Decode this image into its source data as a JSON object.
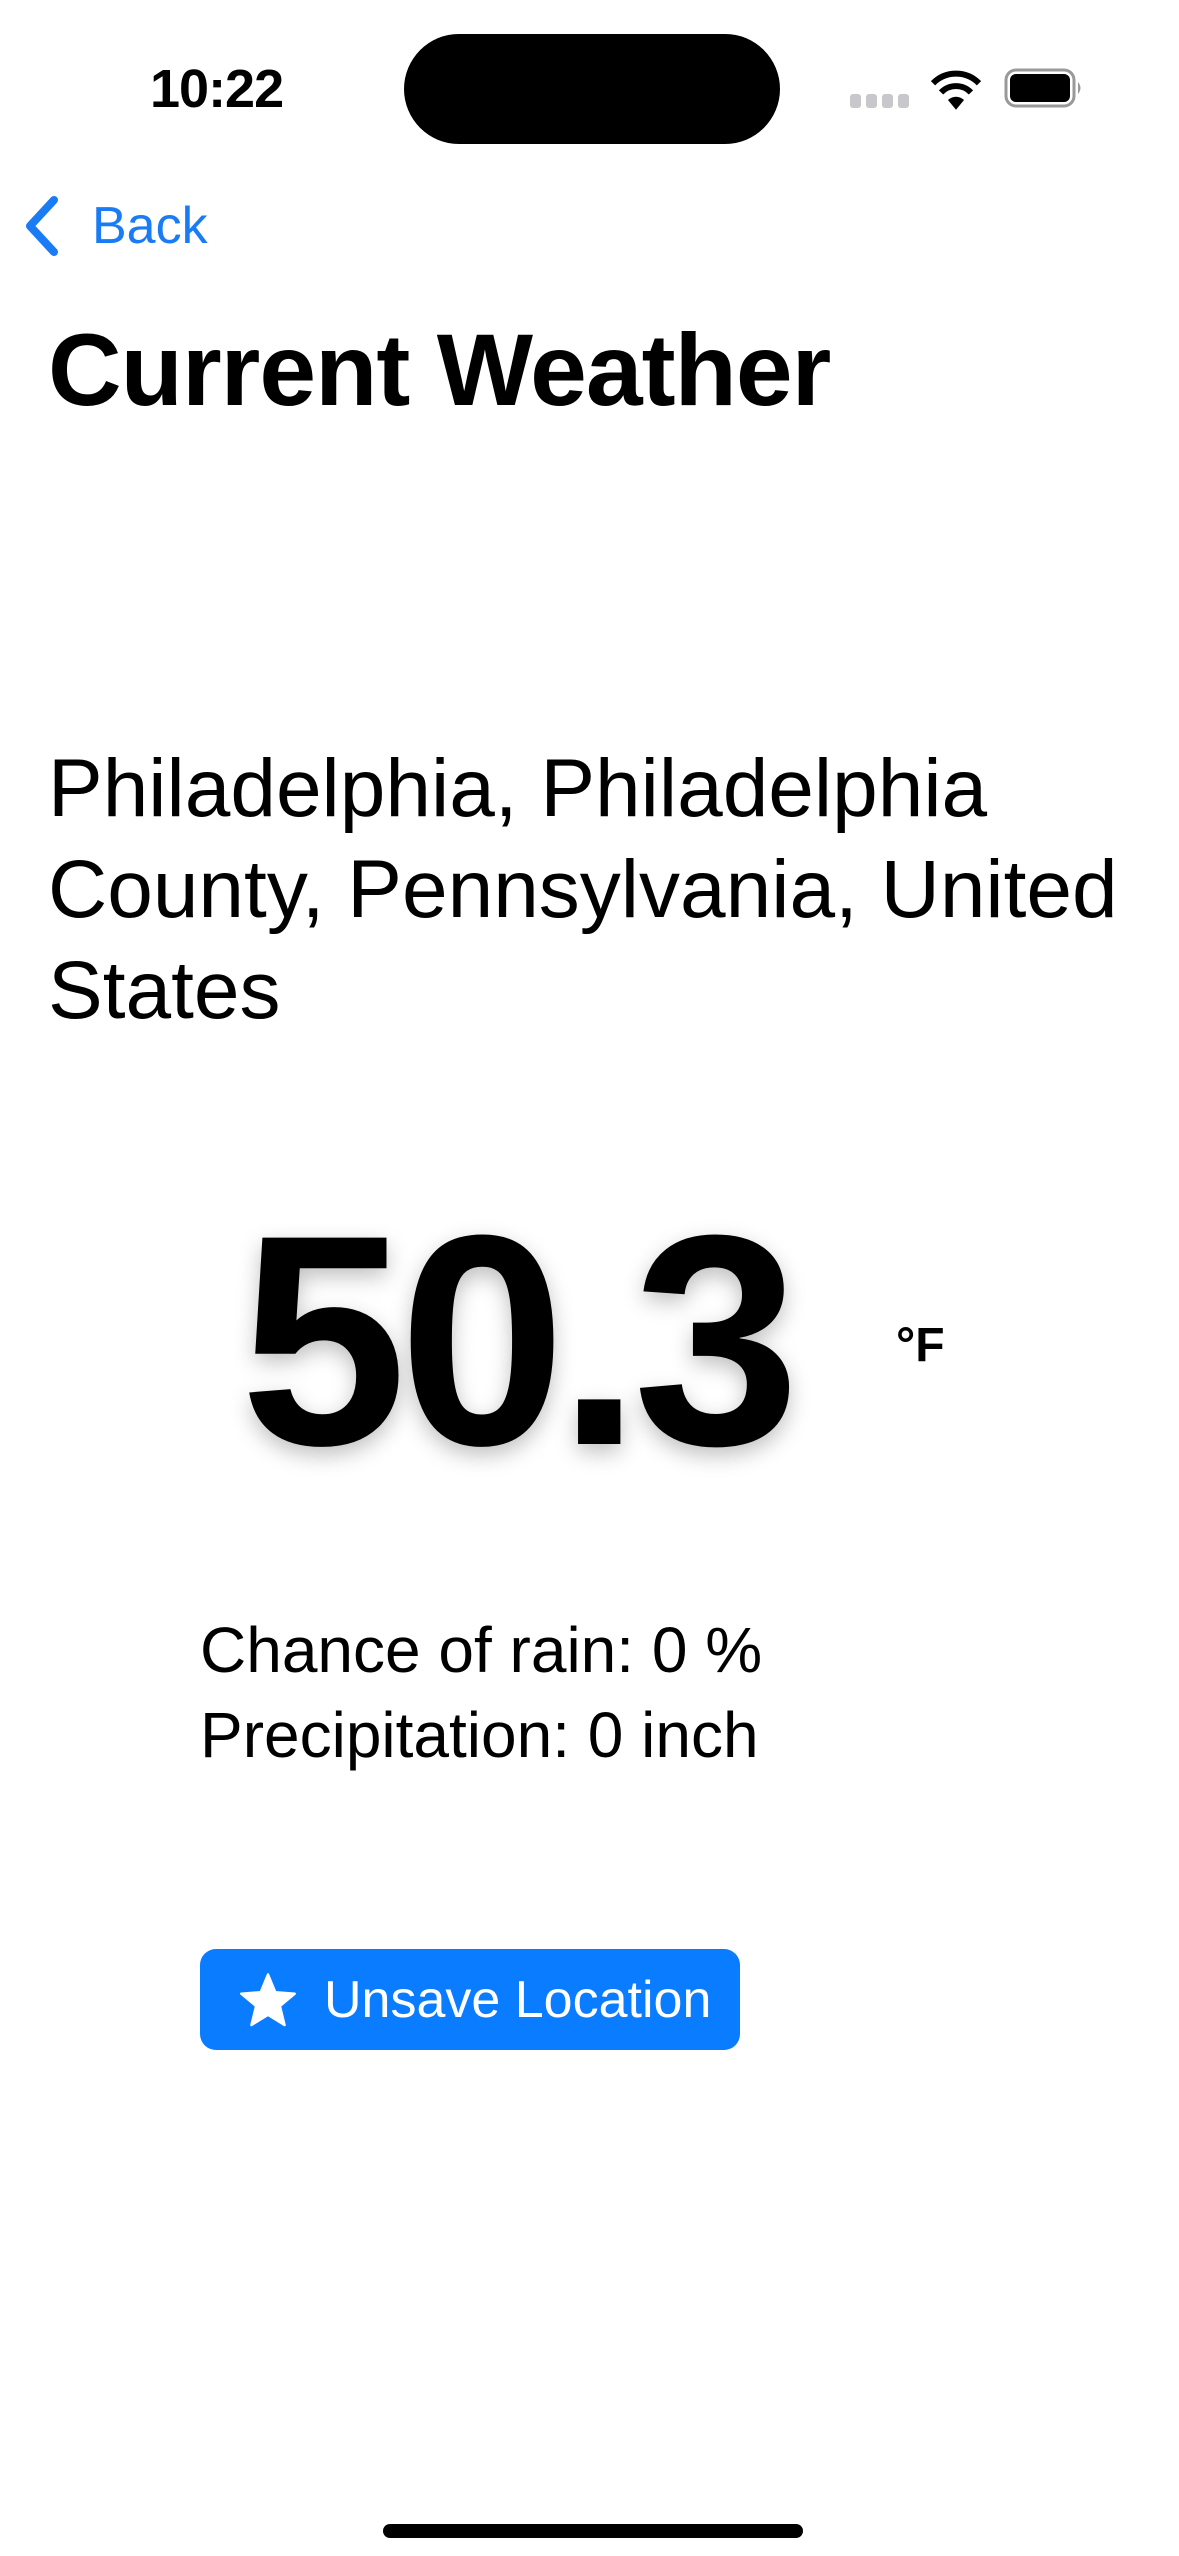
{
  "status_bar": {
    "time": "10:22"
  },
  "nav": {
    "back_label": "Back"
  },
  "header": {
    "title": "Current Weather"
  },
  "location": {
    "name": "Philadelphia, Philadelphia County, Pennsylvania, United States"
  },
  "weather": {
    "temperature": "50.3",
    "unit": "°F",
    "chance_of_rain": "Chance of rain: 0 %",
    "precipitation": "Precipitation: 0 inch"
  },
  "actions": {
    "unsave_label": "Unsave Location"
  },
  "colors": {
    "accent": "#0a7cff",
    "back_link": "#1a7cf5"
  }
}
